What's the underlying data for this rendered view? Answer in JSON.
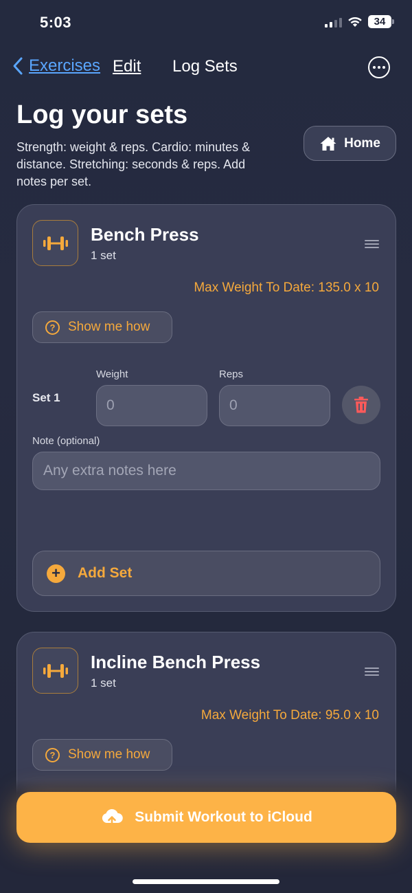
{
  "status_bar": {
    "time": "5:03",
    "battery": "34"
  },
  "nav": {
    "back_label": "Exercises",
    "edit_label": "Edit",
    "title": "Log Sets",
    "more_icon": "ellipsis-circle-icon"
  },
  "header": {
    "title": "Log your sets",
    "subtitle": "Strength: weight & reps. Cardio: minutes & distance. Stretching: seconds & reps. Add notes per set.",
    "home_button": "Home"
  },
  "exercises": [
    {
      "name": "Bench Press",
      "set_count": "1 set",
      "max_weight": "Max Weight To Date: 135.0 x 10",
      "show_me_how": "Show me how",
      "sets": [
        {
          "label": "Set 1",
          "weight_label": "Weight",
          "weight_placeholder": "0",
          "reps_label": "Reps",
          "reps_placeholder": "0"
        }
      ],
      "note_label": "Note (optional)",
      "note_placeholder": "Any extra notes here",
      "add_set": "Add Set"
    },
    {
      "name": "Incline Bench Press",
      "set_count": "1 set",
      "max_weight": "Max Weight To Date: 95.0 x 10",
      "show_me_how": "Show me how"
    }
  ],
  "submit_button": "Submit Workout to iCloud",
  "colors": {
    "accent": "#f5a93c",
    "link": "#5aa6ff",
    "delete": "#ff5a5a",
    "submit": "#fdb347"
  }
}
